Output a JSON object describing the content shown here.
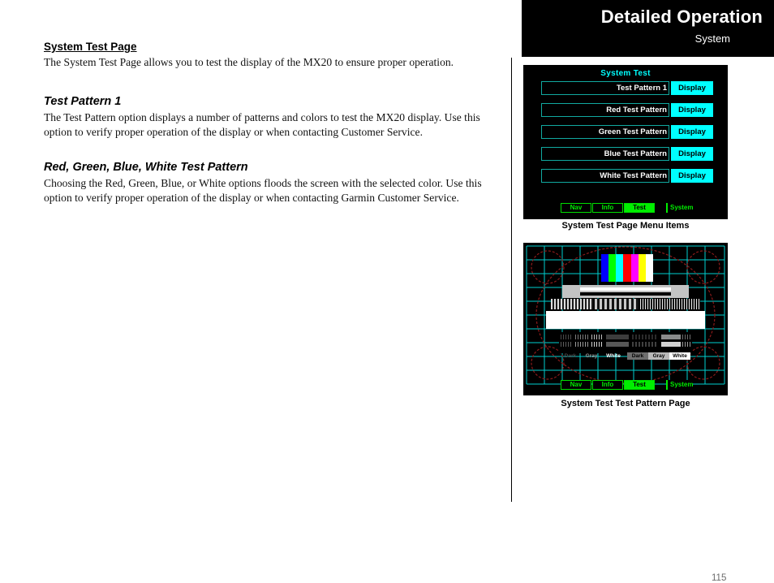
{
  "header": {
    "title": "Detailed Operation",
    "subtitle": "System"
  },
  "page_number": "115",
  "sections": [
    {
      "heading": "System Test Page",
      "heading_style": "bold-underline",
      "body": "The System Test Page allows you to test the display of the MX20 to ensure proper operation."
    },
    {
      "heading": "Test Pattern 1",
      "heading_style": "bold-italic",
      "body": "The Test Pattern option displays a number of patterns and colors to test the MX20 display. Use this option to verify proper operation of the display or when contacting Customer Service."
    },
    {
      "heading": "Red, Green, Blue, White Test Pattern",
      "heading_style": "bold-italic",
      "body": "Choosing the Red, Green, Blue, or White options floods the screen with the selected color. Use this option to verify proper operation of the display or when contacting Garmin Customer Service."
    }
  ],
  "figures": [
    {
      "caption": "System Test Page Menu Items",
      "screen": {
        "title": "System Test",
        "rows": [
          {
            "label": "Test Pattern 1",
            "button": "Display"
          },
          {
            "label": "Red Test Pattern",
            "button": "Display"
          },
          {
            "label": "Green Test Pattern",
            "button": "Display"
          },
          {
            "label": "Blue Test Pattern",
            "button": "Display"
          },
          {
            "label": "White Test Pattern",
            "button": "Display"
          }
        ],
        "tabs": [
          {
            "label": "Nav",
            "active": false
          },
          {
            "label": "Info",
            "active": false
          },
          {
            "label": "Test",
            "active": true
          }
        ],
        "system_tab": "System"
      }
    },
    {
      "caption": "System Test Test Pattern Page",
      "screen": {
        "color_bars": [
          "#0000ff",
          "#00ff00",
          "#00ffff",
          "#ff0000",
          "#ff00ff",
          "#ffff00",
          "#ffffff"
        ],
        "grayscale_labels_left": [
          "Dark",
          "Gray",
          "White"
        ],
        "grayscale_labels_right": [
          "Dark",
          "Gray",
          "White"
        ],
        "tabs": [
          {
            "label": "Nav",
            "active": false
          },
          {
            "label": "Info",
            "active": false
          },
          {
            "label": "Test",
            "active": true
          }
        ],
        "system_tab": "System",
        "grid_color": "#00cfcf",
        "circle_color": "#8b1a1a"
      }
    }
  ],
  "colors": {
    "screen_background": "#000000",
    "menu_title": "#00ffff",
    "menu_button": "#00ffff",
    "menu_field_border": "#11a9a0",
    "tab_green": "#00ee00",
    "page_number": "#6b6b6b"
  }
}
